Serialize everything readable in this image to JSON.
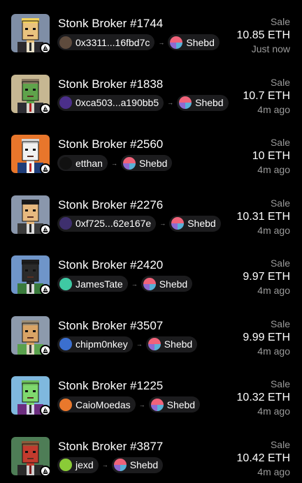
{
  "sales": [
    {
      "title": "Stonk Broker #1744",
      "from": "0x3311...16fbd7c",
      "to": "Shebd",
      "label": "Sale",
      "price": "10.85 ETH",
      "time": "Just now",
      "thumb": {
        "bg": "#7f8ea6",
        "skin": "#e9c37e",
        "hair": "#f2d25b",
        "suit": "#2c2a2e",
        "shirt": "#e9e1c9",
        "tie": "#2a2a2a"
      },
      "from_avatar": "#5e4b3d"
    },
    {
      "title": "Stonk Broker #1838",
      "from": "0xca503...a190bb5",
      "to": "Shebd",
      "label": "Sale",
      "price": "10.7 ETH",
      "time": "4m ago",
      "thumb": {
        "bg": "#c6b792",
        "skin": "#5fa34b",
        "hair": "#8b7a62",
        "suit": "#2d2d33",
        "shirt": "#d9d5cc",
        "tie": "#b22222"
      },
      "from_avatar": "#4b2f8a"
    },
    {
      "title": "Stonk Broker #2560",
      "from": "etthan",
      "to": "Shebd",
      "label": "Sale",
      "price": "10 ETH",
      "time": "4m ago",
      "thumb": {
        "bg": "#e8762b",
        "skin": "#f1f1f1",
        "hair": "#d7d7d7",
        "suit": "#1f3d78",
        "shirt": "#f3f3f3",
        "tie": "#c02828"
      },
      "from_avatar": "#111111"
    },
    {
      "title": "Stonk Broker #2276",
      "from": "0xf725...62e167e",
      "to": "Shebd",
      "label": "Sale",
      "price": "10.31 ETH",
      "time": "4m ago",
      "thumb": {
        "bg": "#8a97ac",
        "skin": "#e7b97f",
        "hair": "#1c1c1c",
        "suit": "#3b3b3b",
        "shirt": "#dcdcdc",
        "tie": "#262626"
      },
      "from_avatar": "#3e2f6e"
    },
    {
      "title": "Stonk Broker #2420",
      "from": "JamesTate",
      "to": "Shebd",
      "label": "Sale",
      "price": "9.97 ETH",
      "time": "4m ago",
      "thumb": {
        "bg": "#6f95c9",
        "skin": "#2b2b2b",
        "hair": "#1e1e1e",
        "suit": "#3a7a3c",
        "shirt": "#d8d8d8",
        "tie": "#1e1e1e"
      },
      "from_avatar": "#3fc9a3"
    },
    {
      "title": "Stonk Broker #3507",
      "from": "chipm0nkey",
      "to": "Shebd",
      "label": "Sale",
      "price": "9.99 ETH",
      "time": "4m ago",
      "thumb": {
        "bg": "#8d9aac",
        "skin": "#d9a466",
        "hair": "#9b8c75",
        "suit": "#5aa14d",
        "shirt": "#e0d8c4",
        "tie": "#3b3b3b"
      },
      "from_avatar": "#3b6fcf"
    },
    {
      "title": "Stonk Broker #1225",
      "from": "CaioMoedas",
      "to": "Shebd",
      "label": "Sale",
      "price": "10.32 ETH",
      "time": "4m ago",
      "thumb": {
        "bg": "#7fb8de",
        "skin": "#7fd86e",
        "hair": "#6dbf5c",
        "suit": "#6c2d7f",
        "shirt": "#d9d4ea",
        "tie": "#2a2a2a"
      },
      "from_avatar": "#e9782c"
    },
    {
      "title": "Stonk Broker #3877",
      "from": "jexd",
      "to": "Shebd",
      "label": "Sale",
      "price": "10.42 ETH",
      "time": "4m ago",
      "thumb": {
        "bg": "#4e7d56",
        "skin": "#c23b2e",
        "hair": "#8a5a3a",
        "suit": "#2a2a2a",
        "shirt": "#d0d0d0",
        "tie": "#7a1d1d"
      },
      "from_avatar": "#8acb37"
    }
  ],
  "to_avatar_colors": [
    "#f0637a",
    "#5ab1d8",
    "#8e6ad2",
    "#ffffff"
  ],
  "chain_icon": "opensea-sailboat-icon",
  "arrow_icon": "right-arrow-icon"
}
